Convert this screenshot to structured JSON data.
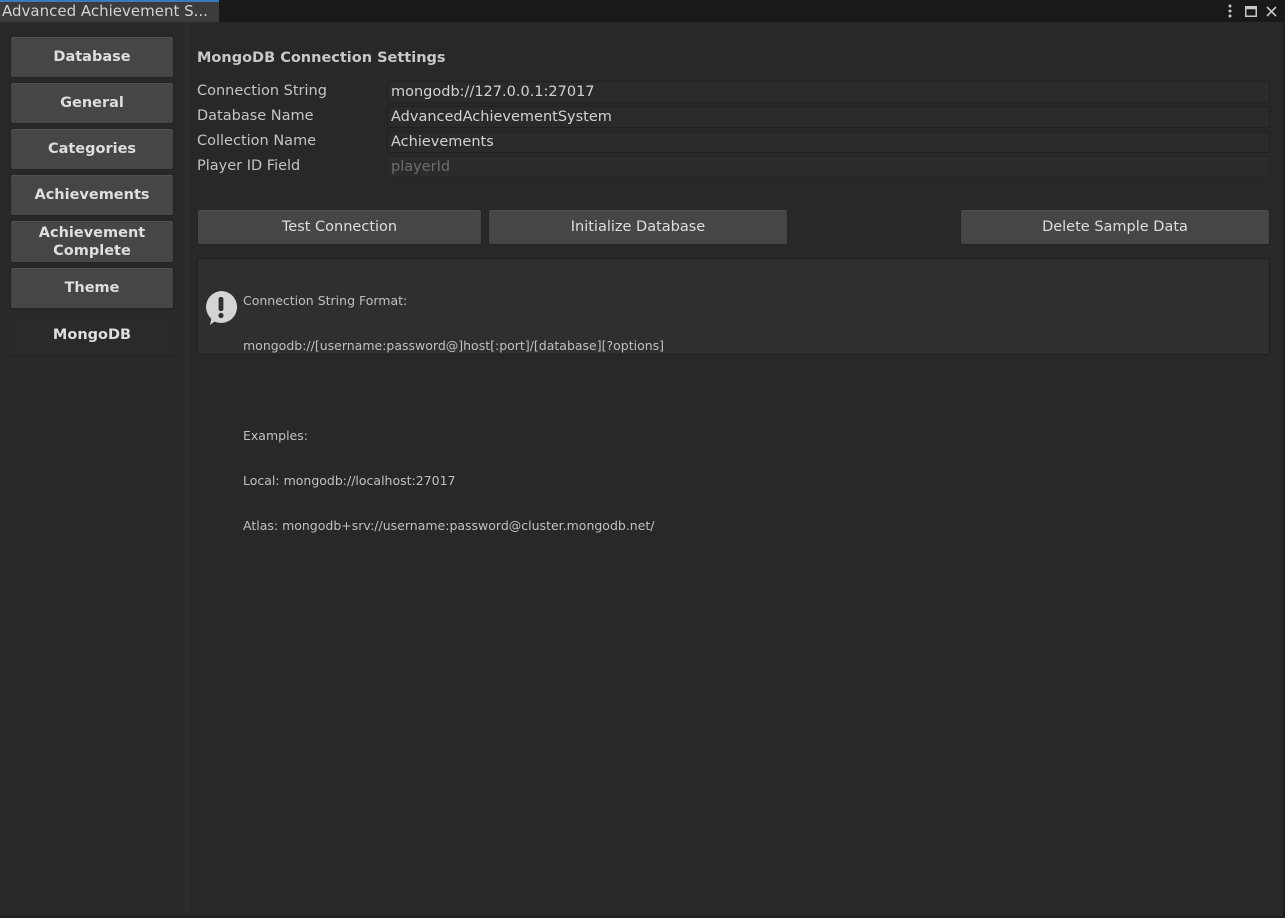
{
  "window": {
    "tab_title": "Advanced Achievement S..."
  },
  "sidebar": {
    "items": [
      {
        "label": "Database"
      },
      {
        "label": "General"
      },
      {
        "label": "Categories"
      },
      {
        "label": "Achievements"
      },
      {
        "label": "Achievement Complete"
      },
      {
        "label": "Theme"
      },
      {
        "label": "MongoDB",
        "active": true
      }
    ]
  },
  "main": {
    "section_title": "MongoDB Connection Settings",
    "fields": [
      {
        "label": "Connection String",
        "value": "mongodb://127.0.0.1:27017"
      },
      {
        "label": "Database Name",
        "value": "AdvancedAchievementSystem"
      },
      {
        "label": "Collection Name",
        "value": "Achievements"
      },
      {
        "label": "Player ID Field",
        "value": "playerId",
        "disabled": true
      }
    ],
    "buttons": {
      "test_connection": "Test Connection",
      "initialize_database": "Initialize Database",
      "delete_sample_data": "Delete Sample Data"
    },
    "help": {
      "icon": "info-exclamation-icon",
      "lines": [
        "Connection String Format:",
        "mongodb://[username:password@]host[:port]/[database][?options]",
        "",
        "Examples:",
        "Local: mongodb://localhost:27017",
        "Atlas: mongodb+srv://username:password@cluster.mongodb.net/"
      ]
    }
  },
  "colors": {
    "background": "#282828",
    "button": "#464646",
    "field": "#2a2a2a",
    "tab_accent": "#3a79bb",
    "text": "#c4c4c4"
  }
}
